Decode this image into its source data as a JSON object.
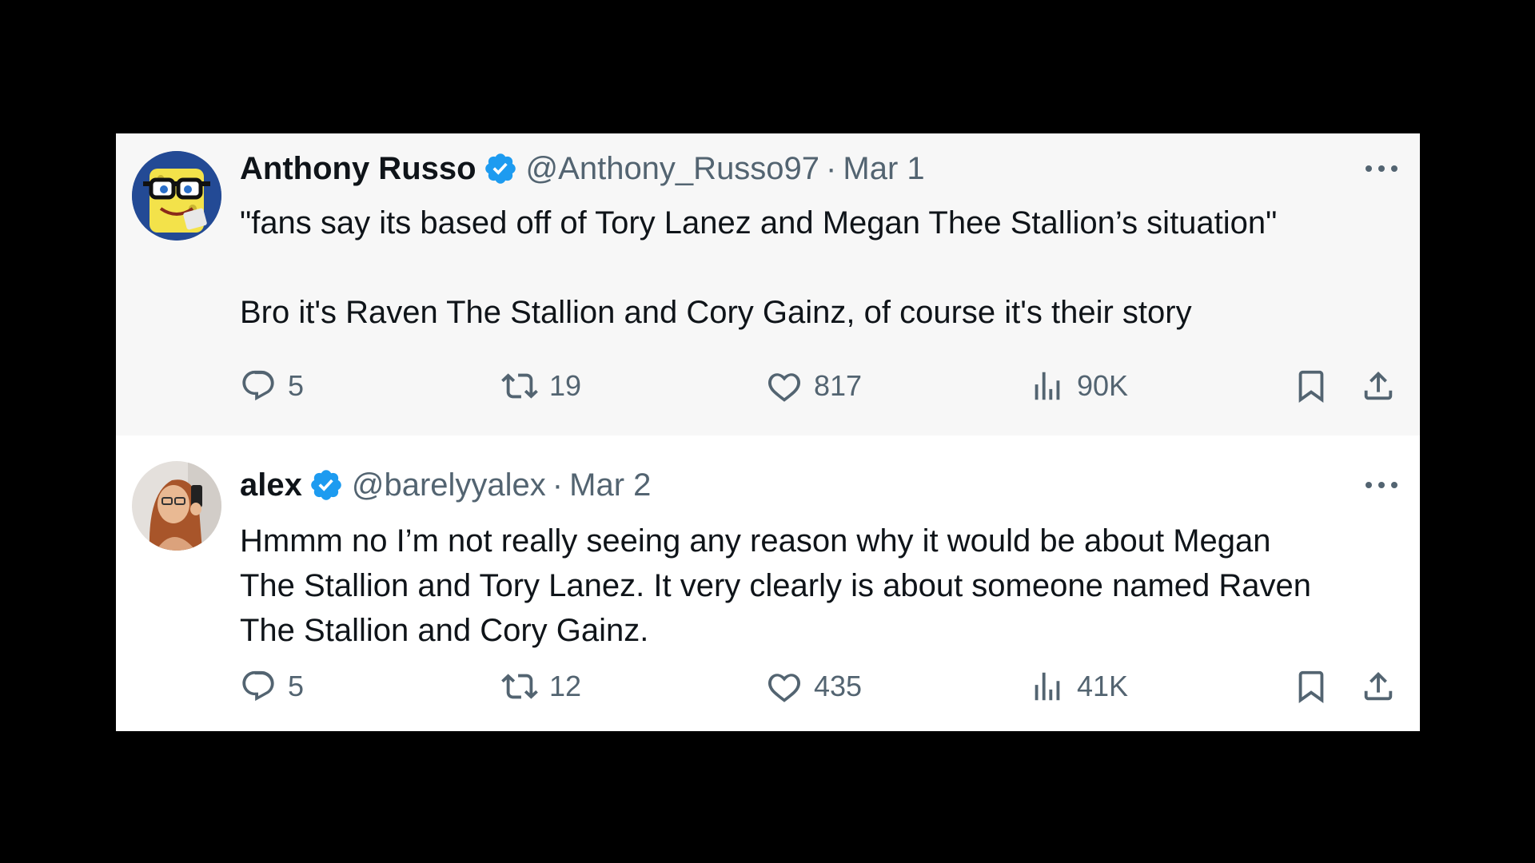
{
  "tweets": [
    {
      "name": "Anthony Russo",
      "handle": "@Anthony_Russo97",
      "separator": "·",
      "date": "Mar 1",
      "text_lines": [
        "\"fans say its based off of Tory Lanez and Megan Thee Stallion’s situation\"",
        "",
        "Bro it's Raven The Stallion and Cory Gainz, of course it's their story"
      ],
      "replies": "5",
      "retweets": "19",
      "likes": "817",
      "views": "90K"
    },
    {
      "name": "alex",
      "handle": "@barelyyalex",
      "separator": "·",
      "date": "Mar 2",
      "text_lines": [
        "Hmmm no I’m not really seeing any reason why it would be about Megan",
        "The Stallion and Tory Lanez. It very clearly is about someone named Raven",
        "The Stallion and Cory Gainz."
      ],
      "replies": "5",
      "retweets": "12",
      "likes": "435",
      "views": "41K"
    }
  ],
  "icons": {
    "verified": "verified-badge-icon",
    "more": "more-icon",
    "reply": "reply-icon",
    "retweet": "retweet-icon",
    "like": "heart-icon",
    "views": "views-icon",
    "bookmark": "bookmark-icon",
    "share": "share-icon"
  },
  "colors": {
    "background": "#000000",
    "card": "#ffffff",
    "first_tweet_bg": "#f7f7f7",
    "text": "#0f1419",
    "secondary": "#536471",
    "verified": "#1d9bf0"
  }
}
